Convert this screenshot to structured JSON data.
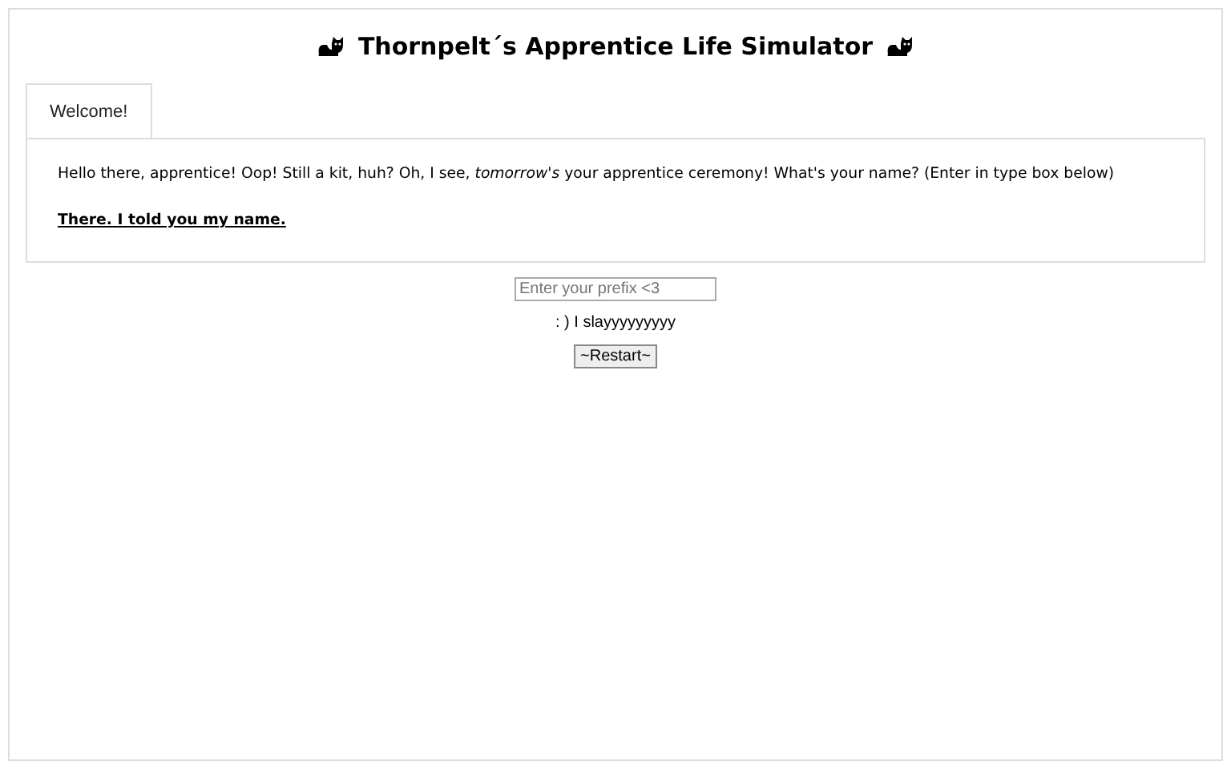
{
  "title": "Thornpelt´s Apprentice Life Simulator",
  "tabs": [
    {
      "label": "Welcome!",
      "selected": true
    }
  ],
  "story": {
    "text": "Hello there, apprentice! Oop! Still a kit, huh? Oh, I see, *tomorrow's* your apprentice ceremony! What's your name? (Enter in type box below)",
    "link": "There. I told you my name."
  },
  "input": {
    "placeholder": "Enter your prefix <3"
  },
  "message": ": ) I slayyyyyyyyy",
  "restart_button": "~Restart~"
}
